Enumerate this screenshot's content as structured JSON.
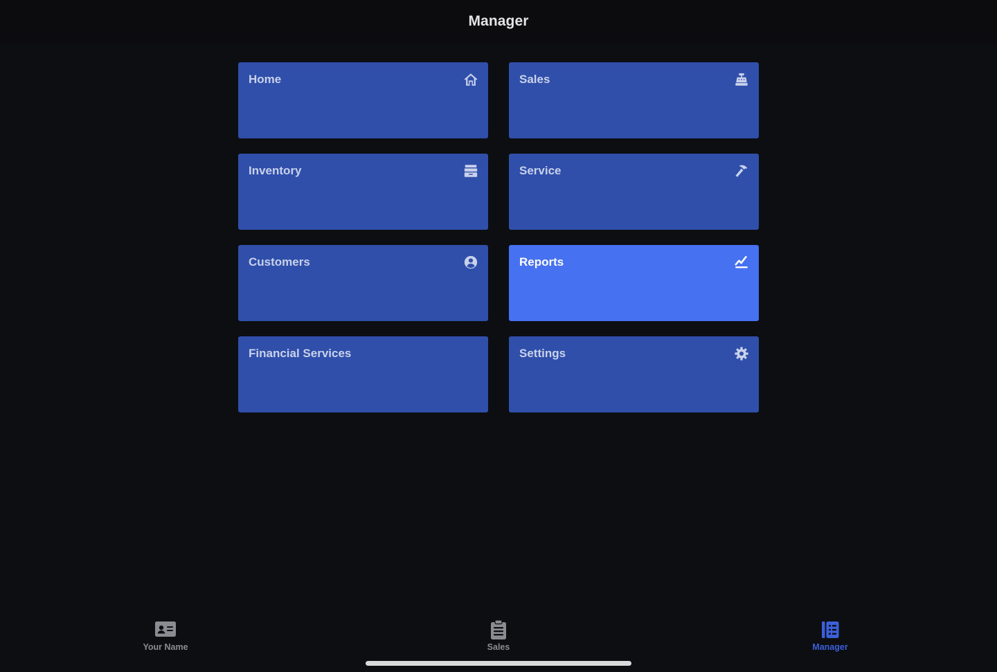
{
  "header": {
    "title": "Manager"
  },
  "tiles": [
    {
      "label": "Home",
      "icon": "home-icon"
    },
    {
      "label": "Sales",
      "icon": "cash-register-icon"
    },
    {
      "label": "Inventory",
      "icon": "archive-box-icon"
    },
    {
      "label": "Service",
      "icon": "hammer-icon"
    },
    {
      "label": "Customers",
      "icon": "user-circle-icon"
    },
    {
      "label": "Reports",
      "icon": "chart-line-icon",
      "selected": true
    },
    {
      "label": "Financial Services",
      "icon": ""
    },
    {
      "label": "Settings",
      "icon": "gear-icon"
    }
  ],
  "tabbar": {
    "items": [
      {
        "label": "Your Name",
        "icon": "id-card-icon"
      },
      {
        "label": "Sales",
        "icon": "clipboard-list-icon"
      },
      {
        "label": "Manager",
        "icon": "manager-book-icon",
        "selected": true
      }
    ]
  },
  "colors": {
    "background": "#0d0e12",
    "tile": "#2f4fab",
    "tile_selected": "#4672f2",
    "tab_selected": "#3a5fd9",
    "tab_inactive": "#8b8c92"
  }
}
